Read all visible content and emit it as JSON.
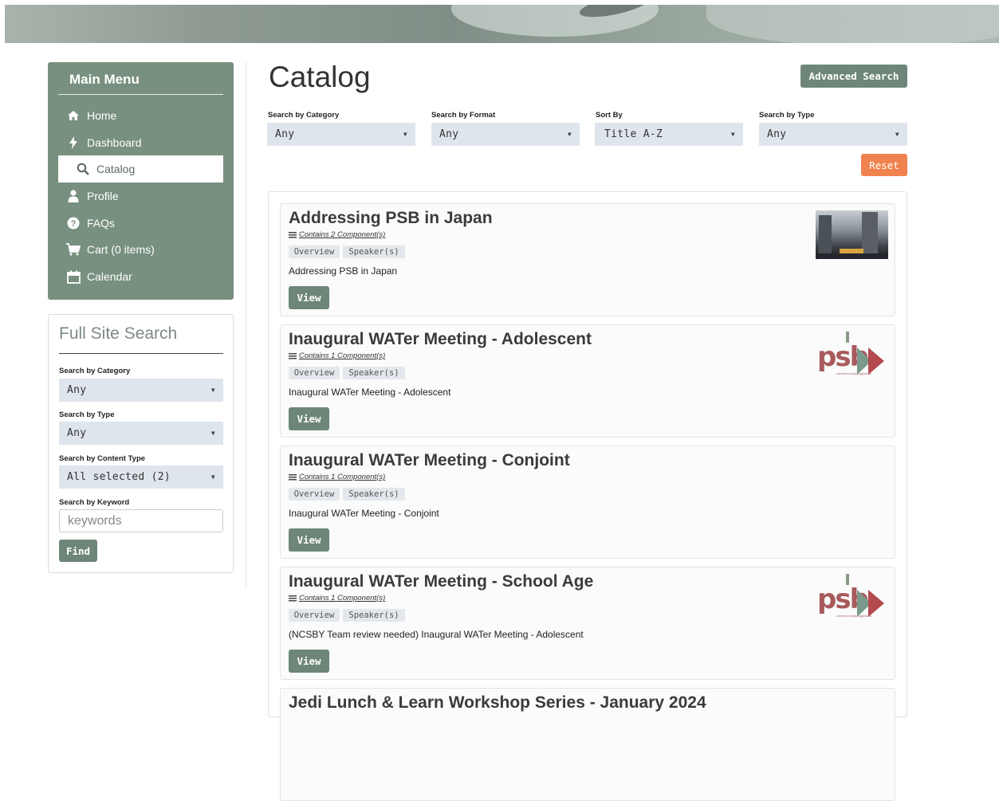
{
  "sidebar": {
    "main_menu_title": "Main Menu",
    "items": [
      {
        "label": "Home",
        "icon": "home-icon"
      },
      {
        "label": "Dashboard",
        "icon": "bolt-icon"
      },
      {
        "label": "Catalog",
        "icon": "search-icon"
      },
      {
        "label": "Profile",
        "icon": "user-icon"
      },
      {
        "label": "FAQs",
        "icon": "question-icon"
      },
      {
        "label": "Cart (0 items)",
        "icon": "cart-icon"
      },
      {
        "label": "Calendar",
        "icon": "calendar-icon"
      }
    ],
    "active_item": "Catalog"
  },
  "site_search": {
    "title": "Full Site Search",
    "category_label": "Search by Category",
    "category_value": "Any",
    "type_label": "Search by Type",
    "type_value": "Any",
    "content_type_label": "Search by Content Type",
    "content_type_value": "All selected (2)",
    "keyword_label": "Search by Keyword",
    "keyword_placeholder": "keywords",
    "find_label": "Find"
  },
  "catalog": {
    "title": "Catalog",
    "advanced_search_label": "Advanced Search",
    "reset_label": "Reset",
    "filters": [
      {
        "label": "Search by Category",
        "value": "Any"
      },
      {
        "label": "Search by Format",
        "value": "Any"
      },
      {
        "label": "Sort By",
        "value": "Title A-Z"
      },
      {
        "label": "Search by Type",
        "value": "Any"
      }
    ],
    "tags": [
      "Overview",
      "Speaker(s)"
    ],
    "view_label": "View",
    "items": [
      {
        "title": "Addressing PSB in Japan",
        "components": "Contains 2 Component(s)",
        "description": "Addressing PSB in Japan",
        "thumbnail": "city-street-photo"
      },
      {
        "title": "Inaugural WATer Meeting - Adolescent",
        "components": "Contains 1 Component(s)",
        "description": "Inaugural WATer Meeting - Adolescent",
        "thumbnail": "psb-logo"
      },
      {
        "title": "Inaugural WATer Meeting - Conjoint",
        "components": "Contains 1 Component(s)",
        "description": "Inaugural WATer Meeting - Conjoint",
        "thumbnail": ""
      },
      {
        "title": "Inaugural WATer Meeting - School Age",
        "components": "Contains 1 Component(s)",
        "description": "(NCSBY Team review needed) Inaugural WATer Meeting - Adolescent",
        "thumbnail": "psb-logo"
      },
      {
        "title": "Jedi Lunch & Learn Workshop Series - January 2024"
      }
    ]
  },
  "logo": {
    "text": "psb",
    "url": "connect.ncsby.org/psbcti"
  },
  "colors": {
    "menu_bg": "#78907f",
    "button_green": "#6e8679",
    "reset_orange": "#f0824f",
    "select_bg": "#dfe5ec"
  }
}
